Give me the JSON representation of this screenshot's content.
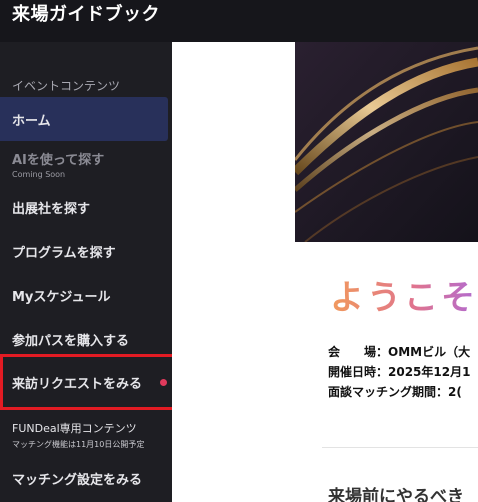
{
  "app": {
    "title": "来場ガイドブック"
  },
  "sidebar": {
    "section_label": "イベントコンテンツ",
    "items": [
      {
        "label": "ホーム"
      },
      {
        "label": "AIを使って探す",
        "sub": "Coming Soon"
      },
      {
        "label": "出展社を探す"
      },
      {
        "label": "プログラムを探す"
      },
      {
        "label": "Myスケジュール"
      },
      {
        "label": "参加パスを購入する"
      },
      {
        "label": "来訪リクエストをみる"
      }
    ],
    "fundeal": {
      "label": "FUNDeal専用コンテンツ",
      "sub": "マッチング機能は11月10日公開予定"
    },
    "matching_settings": {
      "label": "マッチング設定をみる"
    }
  },
  "main": {
    "welcome": "ようこそ、",
    "info": {
      "venue": "会　　場：OMMビル（大",
      "date": "開催日時：2025年12月1",
      "matching": "面談マッチング期間：2("
    },
    "next_heading": "来場前にやるべき"
  },
  "colors": {
    "topbar": "#16161b",
    "sidebar": "#1e1e23",
    "active_item": "#28305a",
    "highlight_border": "#e31b23",
    "badge_dot": "#e03a5c"
  }
}
